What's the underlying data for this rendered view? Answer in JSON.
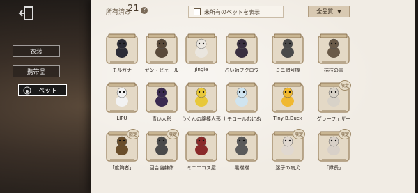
{
  "header": {
    "owned_label": "所有済み",
    "owned_count": "21",
    "help_icon": "?",
    "show_unowned_label": "未所有のペットを表示",
    "filter_label": "全品質"
  },
  "sidebar": {
    "items": [
      {
        "label": "衣装"
      },
      {
        "label": "携帯品"
      },
      {
        "label": "ペット"
      }
    ]
  },
  "pets": [
    {
      "name": "モルガナ",
      "badge": "",
      "color": "#2c2c36"
    },
    {
      "name": "ヤン・ビェール",
      "badge": "",
      "color": "#5a4a3a"
    },
    {
      "name": "Jingle",
      "badge": "",
      "color": "#eae6df"
    },
    {
      "name": "占い師フクロウ",
      "badge": "",
      "color": "#3a2f40"
    },
    {
      "name": "ミニ暗号機",
      "badge": "",
      "color": "#4a4a4a"
    },
    {
      "name": "枯枝の霊",
      "badge": "",
      "color": "#6a5a48"
    },
    {
      "name": "LIPU",
      "badge": "",
      "color": "#f2f2f2"
    },
    {
      "name": "青い人形",
      "badge": "",
      "color": "#3a2a50"
    },
    {
      "name": "うくんの綿棒人形",
      "badge": "",
      "color": "#e8c83a"
    },
    {
      "name": "ナモロールむにぬ",
      "badge": "",
      "color": "#cfe4f0"
    },
    {
      "name": "Tiny B.Duck",
      "badge": "",
      "color": "#f0b830"
    },
    {
      "name": "グレーフェザー",
      "badge": "限定",
      "color": "#d8d2c8"
    },
    {
      "name": "「度胸者」",
      "badge": "限定",
      "color": "#6a4e2a"
    },
    {
      "name": "回合幽隷体",
      "badge": "限定",
      "color": "#4a4a4a"
    },
    {
      "name": "ミニエコス屋",
      "badge": "",
      "color": "#8a2a2a"
    },
    {
      "name": "黒蝶蝶",
      "badge": "",
      "color": "#5a5a5a"
    },
    {
      "name": "迷子の病犬",
      "badge": "限定",
      "color": "#e0d8d0"
    },
    {
      "name": "「隊長」",
      "badge": "限定",
      "color": "#d8d0c8"
    }
  ]
}
